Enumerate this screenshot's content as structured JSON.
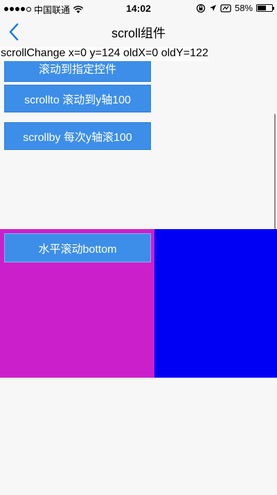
{
  "status_bar": {
    "carrier": "中国联通",
    "time": "14:02",
    "battery": "58%",
    "battery_level": 0.58
  },
  "nav": {
    "title": "scroll组件"
  },
  "scroll_status": {
    "text": "scrollChange x=0 y=124 oldX=0 oldY=122"
  },
  "vertical_buttons": [
    {
      "label": "滚动到指定控件"
    },
    {
      "label": "scrollto 滚动到y轴100"
    },
    {
      "label": "scrollby 每次y轴滚100"
    }
  ],
  "horizontal": {
    "button_label": "水平滚动bottom",
    "colors": {
      "left_pane": "#cc1fcc",
      "right_pane": "#0000f5"
    }
  },
  "colors": {
    "accent": "#1a7cf0",
    "button": "#3d8ee8"
  }
}
